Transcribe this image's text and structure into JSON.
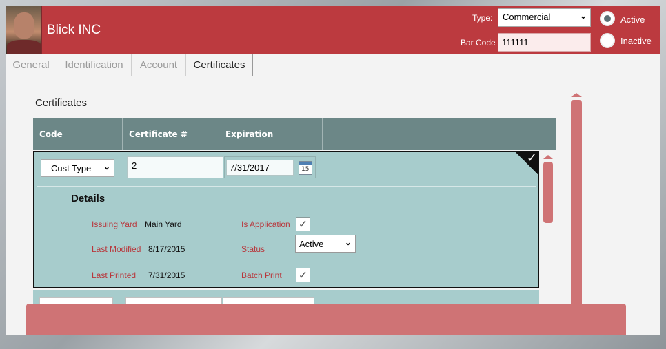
{
  "header": {
    "company_name": "Blick INC",
    "type_label": "Type:",
    "type_value": "Commercial",
    "barcode_label": "Bar Code",
    "barcode_value": "111111",
    "status_options": [
      {
        "label": "Active",
        "checked": true
      },
      {
        "label": "Inactive",
        "checked": false
      }
    ],
    "brand_color": "#bc3a3f"
  },
  "tabs": [
    {
      "label": "General",
      "selected": false
    },
    {
      "label": "Identification",
      "selected": false
    },
    {
      "label": "Account",
      "selected": false
    },
    {
      "label": "Certificates",
      "selected": true
    }
  ],
  "certificates": {
    "title": "Certificates",
    "columns": [
      "Code",
      "Certificate #",
      "Expiration"
    ],
    "rows": [
      {
        "code": "Cust Type",
        "certificate_number": "2",
        "expiration": "7/31/2017",
        "calendar_day": "15",
        "details": {
          "title": "Details",
          "issuing_yard_label": "Issuing Yard",
          "issuing_yard_value": "Main Yard",
          "last_modified_label": "Last Modified",
          "last_modified_value": "8/17/2015",
          "last_printed_label": "Last Printed",
          "last_printed_value": "7/31/2015",
          "is_application_label": "Is Application",
          "is_application_checked": true,
          "status_label": "Status",
          "status_value": "Active",
          "batch_print_label": "Batch Print",
          "batch_print_checked": true
        }
      }
    ]
  },
  "icons": {
    "check_glyph": "✓",
    "chevron_glyph": "⌄"
  },
  "colors": {
    "grid_header": "#6c8787",
    "row_bg": "#a7cccc",
    "label_red": "#b8373c",
    "scroll_pink": "#cf7375"
  }
}
